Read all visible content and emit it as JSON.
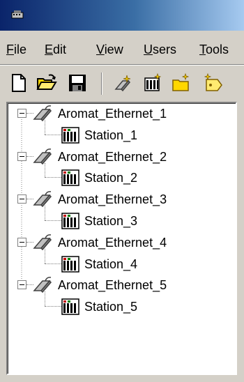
{
  "window": {
    "title": ""
  },
  "menu": {
    "items": [
      {
        "label_rest": "ile",
        "mnemonic": "F"
      },
      {
        "label_rest": "dit",
        "mnemonic": "E"
      },
      {
        "label_rest": "iew",
        "mnemonic": "V"
      },
      {
        "label_rest": "sers",
        "mnemonic": "U"
      },
      {
        "label_rest": "ools",
        "mnemonic": "T"
      }
    ]
  },
  "toolbar": {
    "buttons": [
      {
        "icon": "new-document-icon"
      },
      {
        "icon": "open-folder-icon"
      },
      {
        "icon": "save-disk-icon"
      },
      {
        "icon": "new-channel-icon"
      },
      {
        "icon": "new-device-icon"
      },
      {
        "icon": "new-folder-icon"
      },
      {
        "icon": "new-tag-icon"
      }
    ]
  },
  "tree": {
    "channels": [
      {
        "label": "Aromat_Ethernet_1",
        "device": "Station_1"
      },
      {
        "label": "Aromat_Ethernet_2",
        "device": "Station_2"
      },
      {
        "label": "Aromat_Ethernet_3",
        "device": "Station_3"
      },
      {
        "label": "Aromat_Ethernet_4",
        "device": "Station_4"
      },
      {
        "label": "Aromat_Ethernet_5",
        "device": "Station_5"
      }
    ]
  },
  "colors": {
    "title_gradient_start": "#0a246a",
    "title_gradient_end": "#a6caf0",
    "face": "#d4d0c8",
    "tree_bg": "#ffffff"
  }
}
